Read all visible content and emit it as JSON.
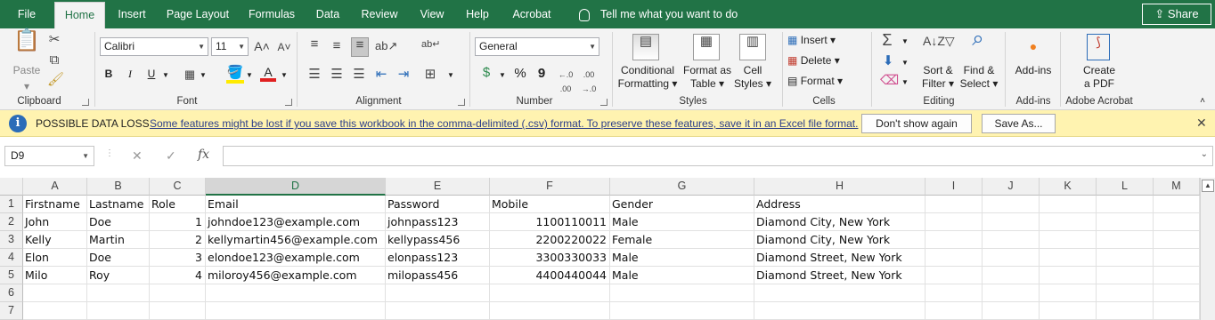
{
  "tabs": [
    "File",
    "Home",
    "Insert",
    "Page Layout",
    "Formulas",
    "Data",
    "Review",
    "View",
    "Help",
    "Acrobat"
  ],
  "tell_me": "Tell me what you want to do",
  "share": "Share",
  "ribbon": {
    "clipboard": {
      "paste": "Paste",
      "label": "Clipboard"
    },
    "font": {
      "name": "Calibri",
      "size": "11",
      "label": "Font",
      "bold": "B",
      "italic": "I",
      "underline": "U"
    },
    "alignment": {
      "label": "Alignment"
    },
    "number": {
      "format": "General",
      "label": "Number",
      "percent": "%",
      "comma": "9",
      "currency": "$"
    },
    "styles": {
      "conditional_1": "Conditional",
      "conditional_2": "Formatting",
      "table_1": "Format as",
      "table_2": "Table",
      "cell_1": "Cell",
      "cell_2": "Styles",
      "label": "Styles"
    },
    "cells": {
      "insert": "Insert",
      "delete": "Delete",
      "format": "Format",
      "label": "Cells"
    },
    "editing": {
      "sort_1": "Sort &",
      "sort_2": "Filter",
      "find_1": "Find &",
      "find_2": "Select",
      "label": "Editing"
    },
    "addins": {
      "btn": "Add-ins",
      "label": "Add-ins"
    },
    "acrobat": {
      "btn_1": "Create",
      "btn_2": "a PDF",
      "label": "Adobe Acrobat"
    }
  },
  "infobar": {
    "title": "POSSIBLE DATA LOSS",
    "message": "Some features might be lost if you save this workbook in the comma-delimited (.csv) format. To preserve these features, save it in an Excel file format.",
    "dont_show": "Don't show again",
    "save_as": "Save As..."
  },
  "formula_bar": {
    "name_box": "D9",
    "formula": ""
  },
  "colors": {
    "accent": "#217346",
    "info_bg": "#fff3b0"
  },
  "grid": {
    "columns": [
      "A",
      "B",
      "C",
      "D",
      "E",
      "F",
      "G",
      "H",
      "I",
      "J",
      "K",
      "L",
      "M"
    ],
    "selected_column": "D",
    "rows": [
      {
        "num": "1",
        "cells": [
          "Firstname",
          "Lastname",
          "Role",
          "Email",
          "Password",
          "Mobile",
          "Gender",
          "Address"
        ]
      },
      {
        "num": "2",
        "cells": [
          "John",
          "Doe",
          "1",
          "johndoe123@example.com",
          "johnpass123",
          "1100110011",
          "Male",
          "Diamond City, New York"
        ]
      },
      {
        "num": "3",
        "cells": [
          "Kelly",
          "Martin",
          "2",
          "kellymartin456@example.com",
          "kellypass456",
          "2200220022",
          "Female",
          "Diamond City, New York"
        ]
      },
      {
        "num": "4",
        "cells": [
          "Elon",
          "Doe",
          "3",
          "elondoe123@example.com",
          "elonpass123",
          "3300330033",
          "Male",
          "Diamond Street, New York"
        ]
      },
      {
        "num": "5",
        "cells": [
          "Milo",
          "Roy",
          "4",
          "miloroy456@example.com",
          "milopass456",
          "4400440044",
          "Male",
          "Diamond Street, New York"
        ]
      },
      {
        "num": "6",
        "cells": []
      },
      {
        "num": "7",
        "cells": []
      }
    ]
  }
}
